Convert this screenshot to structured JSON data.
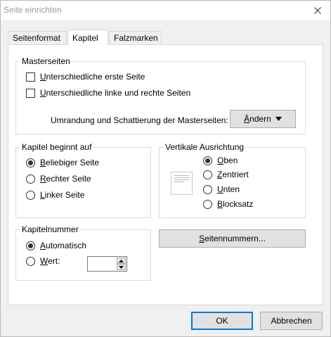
{
  "window": {
    "title": "Seite einrichten",
    "close_icon": "close-icon"
  },
  "tabs": [
    {
      "label": "Seitenformat",
      "active": false
    },
    {
      "label": "Kapitel",
      "active": true
    },
    {
      "label": "Falzmarken",
      "active": false
    }
  ],
  "masterseiten": {
    "title": "Masterseiten",
    "options": [
      {
        "underlined": "U",
        "rest": "nterschiedliche erste Seite",
        "checked": false
      },
      {
        "underlined": "U",
        "rest": "nterschiedliche linke und rechte Seiten",
        "checked": false
      }
    ],
    "border_label": "Umrandung und Schattierung der Masterseiten:",
    "change_button": {
      "underlined": "Ä",
      "rest": "ndern",
      "icon": "triangle-down-icon"
    }
  },
  "kapitel_beginnt": {
    "title": "Kapitel beginnt auf",
    "options": [
      {
        "underlined": "B",
        "rest": "eliebiger Seite",
        "checked": true
      },
      {
        "underlined": "R",
        "rest": "echter Seite",
        "checked": false
      },
      {
        "underlined": "L",
        "rest": "inker Seite",
        "checked": false
      }
    ]
  },
  "vertikale": {
    "title": "Vertikale Ausrichtung",
    "preview_icon": "page-preview-icon",
    "options": [
      {
        "underlined": "O",
        "rest": "ben",
        "checked": true
      },
      {
        "underlined": "Z",
        "rest": "entriert",
        "checked": false
      },
      {
        "underlined": "U",
        "rest": "nten",
        "checked": false
      },
      {
        "underlined": "B",
        "rest": "locksatz",
        "checked": false
      }
    ]
  },
  "kapitelnummer": {
    "title": "Kapitelnummer",
    "options": [
      {
        "underlined": "A",
        "rest": "utomatisch",
        "checked": true
      },
      {
        "underlined": "W",
        "rest": "ert:",
        "checked": false
      }
    ],
    "value": ""
  },
  "seitennummern_button": {
    "underlined": "S",
    "rest": "eitennummern..."
  },
  "footer": {
    "ok_label": "OK",
    "cancel_label": "Abbrechen"
  }
}
